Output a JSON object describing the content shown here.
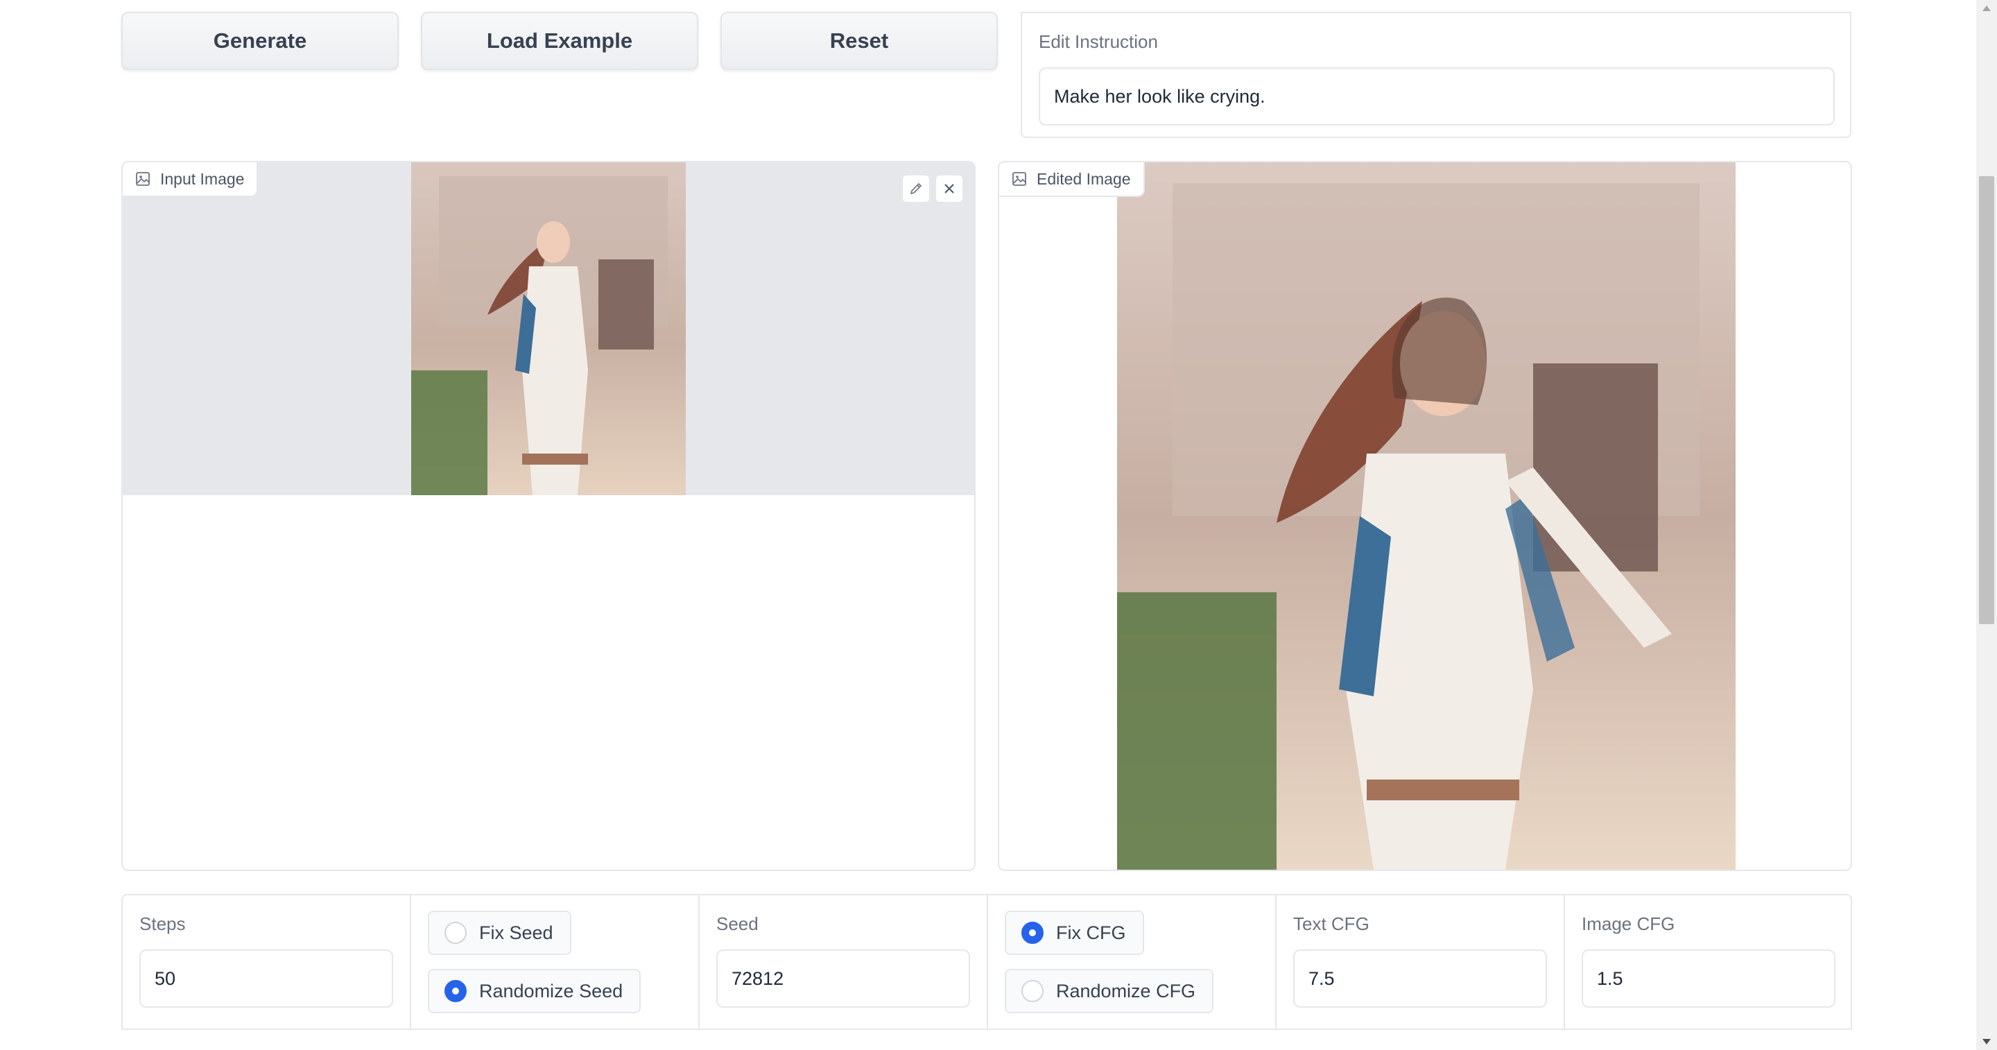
{
  "toolbar": {
    "generate_label": "Generate",
    "load_example_label": "Load Example",
    "reset_label": "Reset"
  },
  "instruction": {
    "label": "Edit Instruction",
    "value": "Make her look like crying."
  },
  "input_panel": {
    "label": "Input Image",
    "icons": [
      "image-icon",
      "pencil-icon",
      "close-icon"
    ]
  },
  "output_panel": {
    "label": "Edited Image",
    "icons": [
      "image-icon"
    ]
  },
  "controls": {
    "steps": {
      "label": "Steps",
      "value": "50"
    },
    "seed_mode": {
      "options": [
        "Fix Seed",
        "Randomize Seed"
      ],
      "selected": "Randomize Seed"
    },
    "seed": {
      "label": "Seed",
      "value": "72812"
    },
    "cfg_mode": {
      "options": [
        "Fix CFG",
        "Randomize CFG"
      ],
      "selected": "Fix CFG"
    },
    "text_cfg": {
      "label": "Text CFG",
      "value": "7.5"
    },
    "image_cfg": {
      "label": "Image CFG",
      "value": "1.5"
    }
  },
  "colors": {
    "accent": "#2563eb",
    "border": "#e5e7eb",
    "panel_bg": "#e5e7eb"
  }
}
